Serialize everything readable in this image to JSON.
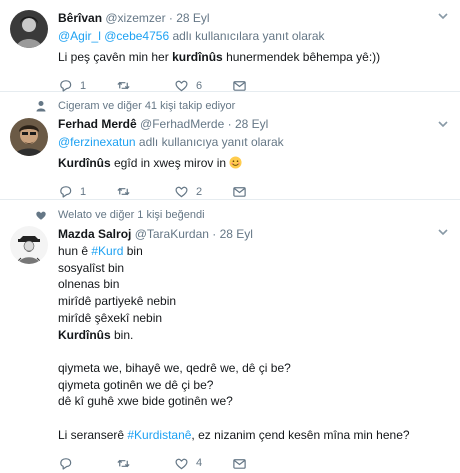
{
  "tweets": [
    {
      "name": "Bêrîvan",
      "handle": "@xizemzer",
      "date": "28 Eyl",
      "reply_to": [
        "@Agir_l",
        "@cebe4756"
      ],
      "reply_suffix": "adlı kullanıcılara yanıt olarak",
      "body_pre": "Li peş çavên min her ",
      "body_kw": "kurdînûs",
      "body_post": "  hunermendek bêhempa yê:))",
      "counts": {
        "reply": "1",
        "retweet": "",
        "like": "6"
      }
    },
    {
      "context": "Cigeram ve diğer 41 kişi takip ediyor",
      "name": "Ferhad Merdê",
      "handle": "@FerhadMerde",
      "date": "28 Eyl",
      "reply_to": [
        "@ferzinexatun"
      ],
      "reply_suffix": "adlı kullanıcıya yanıt olarak",
      "body_kw": "Kurdînûs",
      "body_post": " egîd in xweş mirov in ",
      "emoji": "smiling-face",
      "counts": {
        "reply": "1",
        "retweet": "",
        "like": "2"
      }
    },
    {
      "context": "Welato ve diğer 1 kişi beğendi",
      "name": "Mazda Salroj",
      "handle": "@TaraKurdan",
      "date": "28 Eyl",
      "lines": {
        "l1_pre": "hun ê ",
        "l1_tag": "#Kurd",
        "l1_post": " bin",
        "l2": "sosyalîst bin",
        "l3": "olnenas bin",
        "l4": "mirîdê partiyekê nebin",
        "l5": "mirîdê şêxekî nebin",
        "l6_kw": "Kurdînûs",
        "l6_post": " bin.",
        "q1": "qiymeta we, bihayê we, qedrê we, dê çi be?",
        "q2": "qiymeta gotinên we dê çi be?",
        "q3": "dê kî guhê xwe bide gotinên we?",
        "f_pre": "Li seranserê ",
        "f_tag": "#Kurdistanê",
        "f_post": ", ez nizanim çend kesên mîna min hene?"
      },
      "counts": {
        "reply": "",
        "retweet": "",
        "like": "4"
      }
    }
  ],
  "separator": "·",
  "colors": {
    "text": "#14171a",
    "muted": "#657786",
    "link": "#1da1f2",
    "border": "#e6ecf0"
  }
}
